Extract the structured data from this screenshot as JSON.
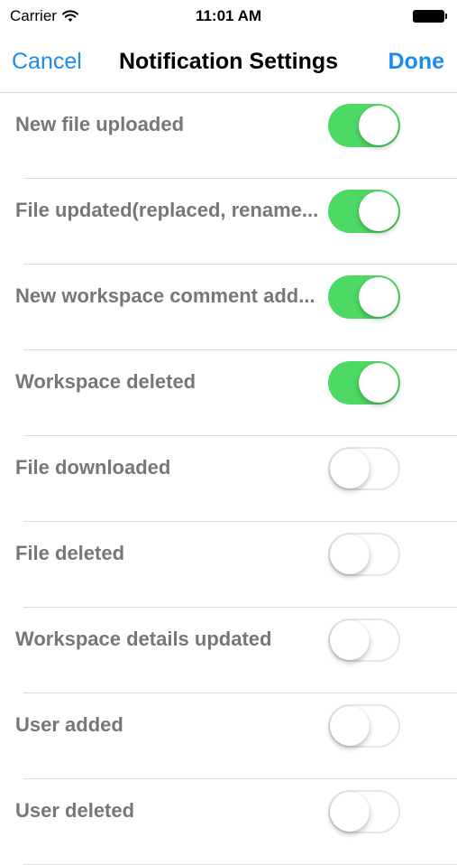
{
  "status_bar": {
    "carrier": "Carrier",
    "time": "11:01 AM"
  },
  "nav": {
    "cancel_label": "Cancel",
    "title": "Notification Settings",
    "done_label": "Done"
  },
  "colors": {
    "accent": "#1a8cf0",
    "toggle_on": "#4cd964",
    "label": "#777777"
  },
  "settings": [
    {
      "label": "New file uploaded",
      "enabled": true
    },
    {
      "label": "File updated(replaced, rename...",
      "enabled": true
    },
    {
      "label": "New workspace comment add...",
      "enabled": true
    },
    {
      "label": "Workspace deleted",
      "enabled": true
    },
    {
      "label": "File downloaded",
      "enabled": false
    },
    {
      "label": "File deleted",
      "enabled": false
    },
    {
      "label": "Workspace details updated",
      "enabled": false
    },
    {
      "label": "User added",
      "enabled": false
    },
    {
      "label": "User deleted",
      "enabled": false
    }
  ]
}
